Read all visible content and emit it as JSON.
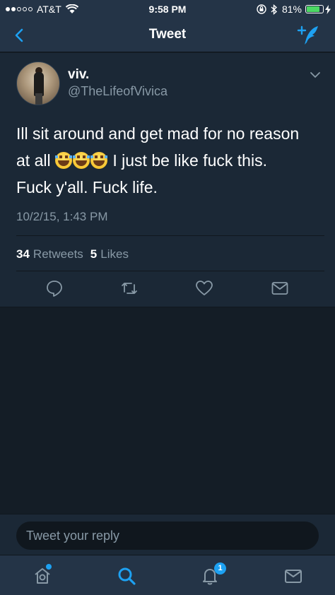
{
  "status_bar": {
    "carrier": "AT&T",
    "time": "9:58 PM",
    "battery": "81%",
    "battery_level": 0.81
  },
  "nav": {
    "title": "Tweet",
    "back_icon": "chevron-left-icon",
    "compose_icon": "compose-tweet-icon"
  },
  "tweet": {
    "display_name": "viv.",
    "username": "@TheLifeofVivica",
    "text_line1": "Ill sit around and get mad for no reason",
    "text_line2_a": "at all",
    "text_line2_b": " I just be like fuck this.",
    "text_line3": "Fuck y'all. Fuck life.",
    "emoji": "face-with-tears-of-joy",
    "timestamp": "10/2/15, 1:43 PM",
    "retweets_count": "34",
    "retweets_label": "Retweets",
    "likes_count": "5",
    "likes_label": "Likes"
  },
  "reply": {
    "placeholder": "Tweet your reply"
  },
  "tab_bar": {
    "notifications_badge": "1"
  },
  "colors": {
    "background": "#141d26",
    "card": "#1b2836",
    "bar": "#243447",
    "accent": "#1da1f2",
    "muted_text": "#8899a6"
  }
}
